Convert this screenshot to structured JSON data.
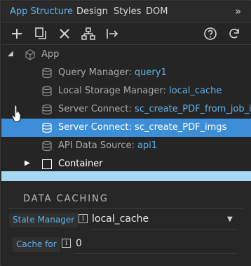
{
  "tabs": {
    "items": [
      "App Structure",
      "Design",
      "Styles",
      "DOM"
    ],
    "more_label": "»"
  },
  "toolbar": {
    "icons": [
      "add-icon",
      "duplicate-icon",
      "delete-icon",
      "sitemap-icon",
      "move-out-icon",
      "help-icon",
      "refresh-icon"
    ]
  },
  "tree": {
    "root_label": "App",
    "items": [
      {
        "key": "Query Manager:",
        "value": "query1"
      },
      {
        "key": "Local Storage Manager:",
        "value": "local_cache"
      },
      {
        "key": "Server Connect:",
        "value": "sc_create_PDF_from_job_id"
      },
      {
        "key": "Server Connect:",
        "value": "sc_create_PDF_imgs"
      },
      {
        "key": "API Data Source:",
        "value": "api1"
      }
    ],
    "container_label": "Container"
  },
  "panel": {
    "section_title": "DATA CACHING",
    "state_manager_label": "State Manager",
    "state_manager_value": "local_cache",
    "cache_for_label": "Cache for",
    "cache_for_value": "0"
  },
  "colors": {
    "accent": "#5fb2ea",
    "selected_row": "#3d8ed8",
    "divider": "#a7d8f2"
  }
}
